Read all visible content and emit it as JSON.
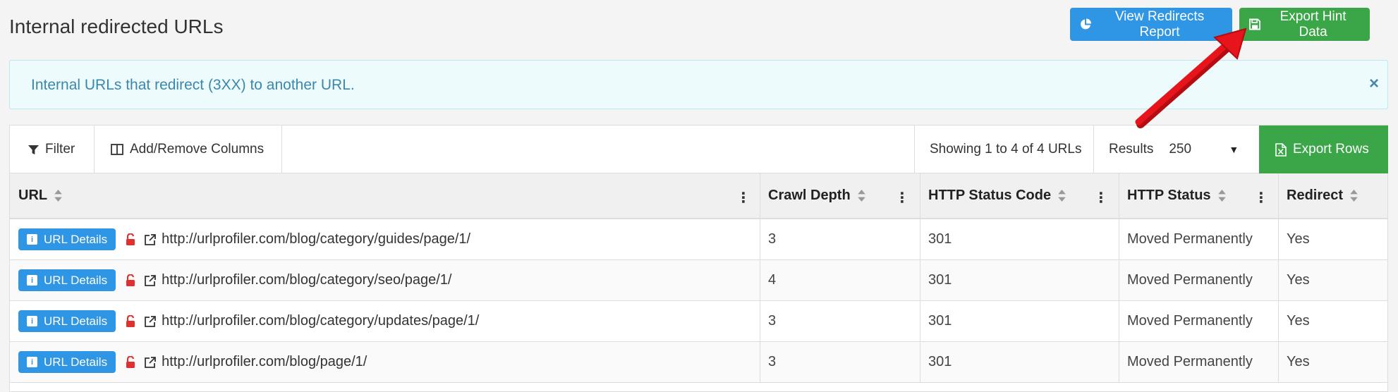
{
  "page": {
    "title": "Internal redirected URLs"
  },
  "header_buttons": {
    "view_report": "View Redirects Report",
    "export_hint": "Export Hint Data"
  },
  "info": {
    "message": "Internal URLs that redirect (3XX) to another URL.",
    "close": "×"
  },
  "toolbar": {
    "filter": "Filter",
    "columns": "Add/Remove Columns",
    "showing": "Showing 1 to 4 of 4 URLs",
    "results_label": "Results",
    "results_value": "250",
    "export_rows": "Export Rows"
  },
  "table": {
    "columns": [
      "URL",
      "Crawl Depth",
      "HTTP Status Code",
      "HTTP Status",
      "Redirect"
    ],
    "details_label": "URL Details",
    "rows": [
      {
        "url": "http://urlprofiler.com/blog/category/guides/page/1/",
        "depth": "3",
        "code": "301",
        "status": "Moved Permanently",
        "redirect": "Yes"
      },
      {
        "url": "http://urlprofiler.com/blog/category/seo/page/1/",
        "depth": "4",
        "code": "301",
        "status": "Moved Permanently",
        "redirect": "Yes"
      },
      {
        "url": "http://urlprofiler.com/blog/category/updates/page/1/",
        "depth": "3",
        "code": "301",
        "status": "Moved Permanently",
        "redirect": "Yes"
      },
      {
        "url": "http://urlprofiler.com/blog/page/1/",
        "depth": "3",
        "code": "301",
        "status": "Moved Permanently",
        "redirect": "Yes"
      }
    ]
  },
  "colors": {
    "primary": "#2f96e6",
    "success": "#3aa648",
    "info_bg": "#eefbfd",
    "info_text": "#3a87ad",
    "lock": "#e03131",
    "annotation_arrow": "#e8141b"
  },
  "icons": {
    "report": "pie-chart-icon",
    "export_hint": "save-icon",
    "close": "close-icon",
    "filter": "filter-icon",
    "columns": "columns-icon",
    "export_rows": "excel-file-icon",
    "sort": "sort-icon",
    "column_menu": "kebab-menu-icon",
    "details": "info-icon",
    "insecure": "unlocked-icon",
    "external": "external-link-icon"
  }
}
